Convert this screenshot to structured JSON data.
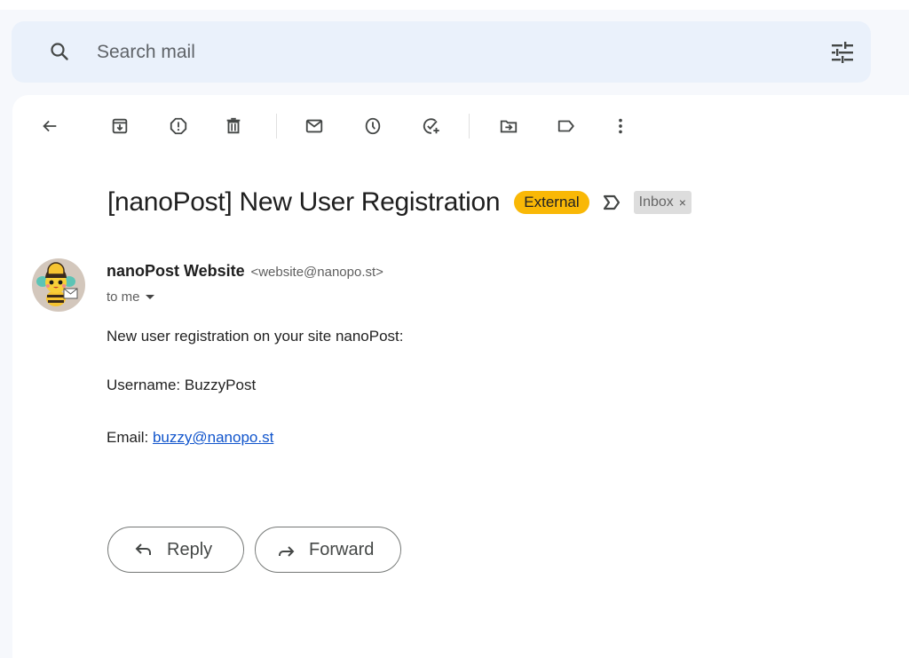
{
  "search": {
    "placeholder": "Search mail",
    "search_icon": "search-icon",
    "filter_icon": "tune-icon"
  },
  "toolbar": {
    "buttons": [
      {
        "name": "back",
        "icon": "arrow-left-icon"
      },
      {
        "name": "archive",
        "icon": "archive-icon"
      },
      {
        "name": "report-spam",
        "icon": "report-icon"
      },
      {
        "name": "delete",
        "icon": "trash-icon"
      },
      {
        "name": "mark-unread",
        "icon": "envelope-icon"
      },
      {
        "name": "snooze",
        "icon": "clock-icon"
      },
      {
        "name": "add-to-tasks",
        "icon": "task-add-icon"
      },
      {
        "name": "move-to",
        "icon": "folder-move-icon"
      },
      {
        "name": "label",
        "icon": "label-icon"
      },
      {
        "name": "more",
        "icon": "more-vert-icon"
      }
    ]
  },
  "email": {
    "subject": "[nanoPost] New User Registration",
    "badges": {
      "external": "External",
      "external_color": "#f9b806"
    },
    "labels": [
      {
        "text": "Inbox",
        "remove": "×"
      }
    ],
    "sender": {
      "name": "nanoPost Website",
      "email": "<website@nanopo.st>",
      "avatar": "bee-mascot-avatar"
    },
    "recipients": "to me",
    "body": {
      "line1": "New user registration on your site nanoPost:",
      "username_label": "Username: BuzzyPost",
      "email_label": "Email: ",
      "email_link": "buzzy@nanopo.st"
    }
  },
  "actions": {
    "reply": "Reply",
    "forward": "Forward"
  },
  "colors": {
    "background": "#f6f8fc",
    "search_bg": "#eaf1fb",
    "link": "#1155cc"
  }
}
